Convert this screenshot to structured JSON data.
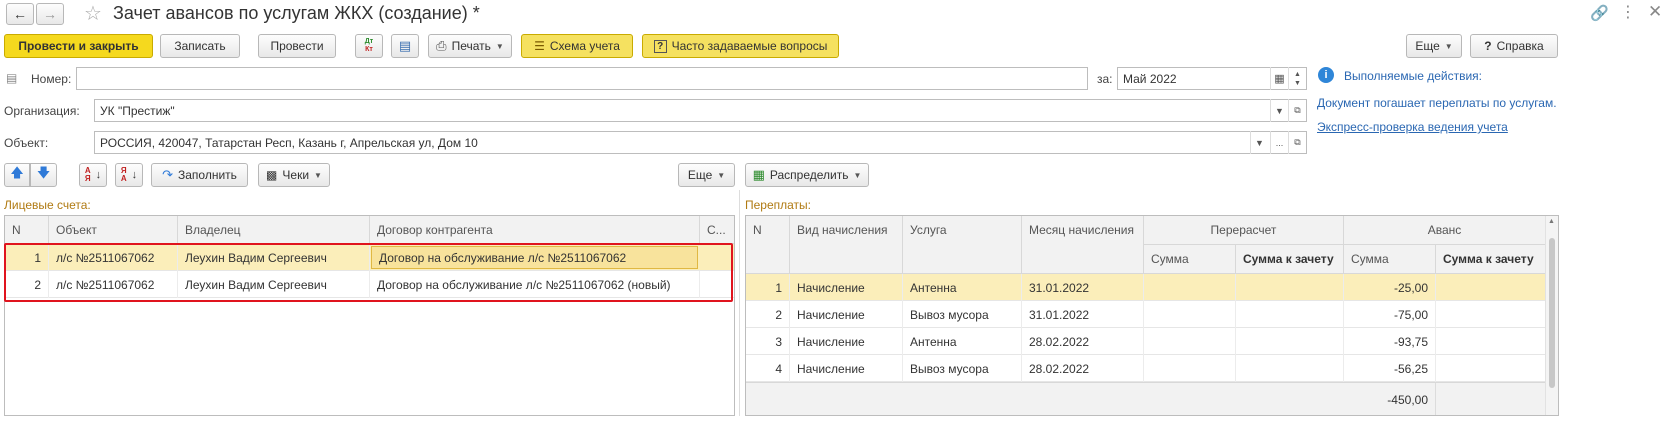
{
  "title": "Зачет авансов по услугам ЖКХ (создание) *",
  "toolbar": {
    "post_close": "Провести и закрыть",
    "save": "Записать",
    "post": "Провести",
    "dtkt": "ДтКт",
    "print": "Печать",
    "scheme": "Схема учета",
    "faq": "Часто задаваемые вопросы",
    "more": "Еще",
    "help": "Справка"
  },
  "form": {
    "number_label": "Номер:",
    "number_value": "",
    "date_label": "за:",
    "date_value": "Май 2022",
    "org_label": "Организация:",
    "org_value": "УК \"Престиж\"",
    "obj_label": "Объект:",
    "obj_value": "РОССИЯ, 420047, Татарстан Респ, Казань г, Апрельская ул, Дом 10"
  },
  "info": {
    "actions": "Выполняемые действия:",
    "description": "Документ погашает переплаты по услугам.",
    "check_link": "Экспресс-проверка ведения учета"
  },
  "left": {
    "fill": "Заполнить",
    "checks": "Чеки",
    "more": "Еще",
    "section": "Лицевые счета:",
    "columns": [
      "N",
      "Объект",
      "Владелец",
      "Договор контрагента",
      "С..."
    ],
    "rows": [
      {
        "n": "1",
        "object": "л/с №2511067062",
        "owner": "Леухин Вадим Сергеевич",
        "contract": "Договор на обслуживание л/с №2511067062"
      },
      {
        "n": "2",
        "object": "л/с №2511067062",
        "owner": "Леухин Вадим Сергеевич",
        "contract": "Договор на обслуживание л/с №2511067062 (новый)"
      }
    ]
  },
  "right": {
    "distribute": "Распределить",
    "section": "Переплаты:",
    "columns": {
      "n": "N",
      "kind": "Вид начисления",
      "service": "Услуга",
      "month": "Месяц начисления",
      "recalc": "Перерасчет",
      "advance": "Аванс",
      "sum": "Сумма",
      "sum_offset": "Сумма к зачету"
    },
    "rows": [
      {
        "n": "1",
        "kind": "Начисление",
        "service": "Антенна",
        "month": "31.01.2022",
        "advance_sum": "-25,00"
      },
      {
        "n": "2",
        "kind": "Начисление",
        "service": "Вывоз мусора",
        "month": "31.01.2022",
        "advance_sum": "-75,00"
      },
      {
        "n": "3",
        "kind": "Начисление",
        "service": "Антенна",
        "month": "28.02.2022",
        "advance_sum": "-93,75"
      },
      {
        "n": "4",
        "kind": "Начисление",
        "service": "Вывоз мусора",
        "month": "28.02.2022",
        "advance_sum": "-56,25"
      }
    ],
    "total": "-450,00"
  },
  "colors": {
    "accent_yellow": "#f5d91e",
    "selection": "#fbeeba",
    "highlight_border": "#e0141e",
    "section_label": "#b07a12",
    "link": "#2a67b2"
  }
}
